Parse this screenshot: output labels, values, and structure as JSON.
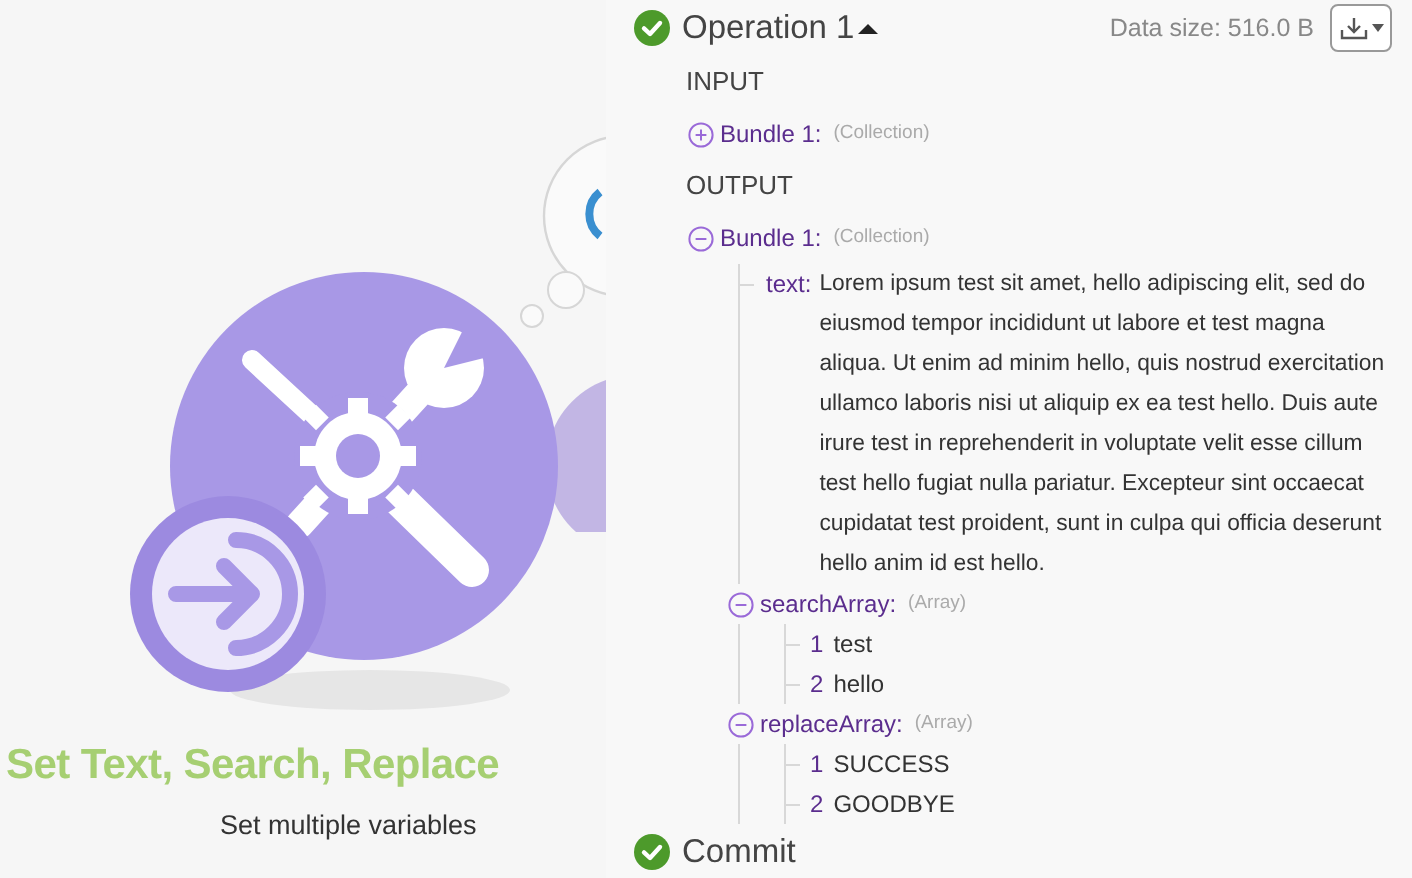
{
  "canvas": {
    "module": {
      "title": "Set Text, Search, Replace",
      "subtitle": "Set multiple variables"
    }
  },
  "panel": {
    "operations": [
      {
        "title": "Operation 1",
        "succeeded": true,
        "expanded": true,
        "data_size": "Data size: 516.0 B",
        "sections": [
          {
            "heading": "INPUT",
            "bundles": [
              {
                "label": "Bundle 1:",
                "type": "(Collection)",
                "expanded": false
              }
            ]
          },
          {
            "heading": "OUTPUT",
            "bundles": [
              {
                "label": "Bundle 1:",
                "type": "(Collection)",
                "expanded": true,
                "children": [
                  {
                    "kind": "value",
                    "key": "text:",
                    "value": "Lorem ipsum test sit amet, hello adipiscing elit, sed do eiusmod tempor incididunt ut labore et test magna aliqua. Ut enim ad minim hello, quis nostrud exercitation ullamco laboris nisi ut aliquip ex ea test hello. Duis aute irure test in reprehenderit in voluptate velit esse cillum test hello fugiat nulla pariatur. Excepteur sint occaecat cupidatat test proident, sunt in culpa qui officia deserunt hello anim id est hello."
                  },
                  {
                    "kind": "array",
                    "key": "searchArray:",
                    "type": "(Array)",
                    "expanded": true,
                    "children": [
                      {
                        "kind": "item",
                        "index": "1",
                        "value": "test"
                      },
                      {
                        "kind": "item",
                        "index": "2",
                        "value": "hello"
                      }
                    ]
                  },
                  {
                    "kind": "array",
                    "key": "replaceArray:",
                    "type": "(Array)",
                    "expanded": true,
                    "children": [
                      {
                        "kind": "item",
                        "index": "1",
                        "value": "SUCCESS"
                      },
                      {
                        "kind": "item",
                        "index": "2",
                        "value": "GOODBYE"
                      }
                    ]
                  }
                ]
              }
            ]
          }
        ]
      },
      {
        "title": "Commit",
        "succeeded": true
      }
    ]
  }
}
